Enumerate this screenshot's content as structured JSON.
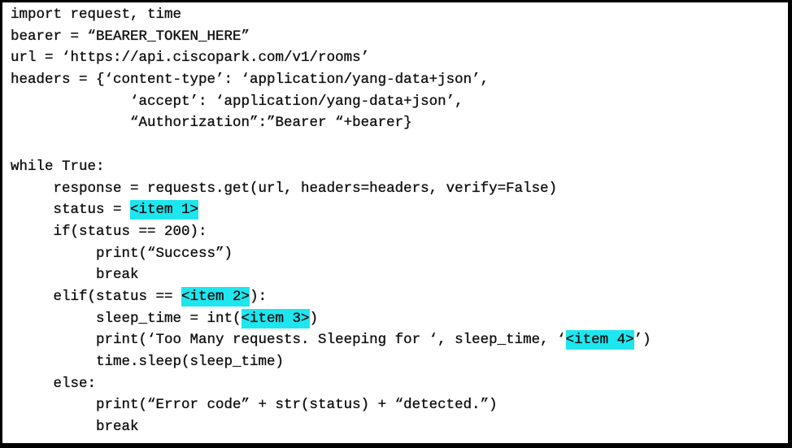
{
  "document": {
    "highlight_color": "#1ee6ef",
    "lines": [
      {
        "indent": "",
        "parts": [
          {
            "text": "import request, time"
          }
        ]
      },
      {
        "indent": "",
        "parts": [
          {
            "text": "bearer = “BEARER_TOKEN_HERE”"
          }
        ]
      },
      {
        "indent": "",
        "parts": [
          {
            "text": "url = ‘https://api.ciscopark.com/v1/rooms’"
          }
        ]
      },
      {
        "indent": "",
        "parts": [
          {
            "text": "headers = {‘content-type’: ‘application/yang-data+json’,"
          }
        ]
      },
      {
        "indent": "",
        "parts": [
          {
            "text": "              ‘accept’: ‘application/yang-data+json’,"
          }
        ]
      },
      {
        "indent": "",
        "parts": [
          {
            "text": "              “Authorization”:”Bearer “+bearer}"
          }
        ]
      },
      {
        "indent": "",
        "parts": [
          {
            "text": ""
          }
        ]
      },
      {
        "indent": "",
        "parts": [
          {
            "text": "while True:"
          }
        ]
      },
      {
        "indent": "",
        "parts": [
          {
            "text": "     response = requests.get(url, headers=headers, verify=False)"
          }
        ]
      },
      {
        "indent": "",
        "parts": [
          {
            "text": "     status = "
          },
          {
            "text": "<item 1>",
            "highlight": true
          }
        ]
      },
      {
        "indent": "",
        "parts": [
          {
            "text": "     if(status == 200):"
          }
        ]
      },
      {
        "indent": "",
        "parts": [
          {
            "text": "          print(“Success”)"
          }
        ]
      },
      {
        "indent": "",
        "parts": [
          {
            "text": "          break"
          }
        ]
      },
      {
        "indent": "",
        "parts": [
          {
            "text": "     elif(status == "
          },
          {
            "text": "<item 2>",
            "highlight": true
          },
          {
            "text": "):"
          }
        ]
      },
      {
        "indent": "",
        "parts": [
          {
            "text": "          sleep_time = int("
          },
          {
            "text": "<item 3>",
            "highlight": true
          },
          {
            "text": ")"
          }
        ]
      },
      {
        "indent": "",
        "parts": [
          {
            "text": "          print(‘Too Many requests. Sleeping for ‘, sleep_time, ‘"
          },
          {
            "text": "<item 4>",
            "highlight": true
          },
          {
            "text": "’)"
          }
        ]
      },
      {
        "indent": "",
        "parts": [
          {
            "text": "          time.sleep(sleep_time)"
          }
        ]
      },
      {
        "indent": "",
        "parts": [
          {
            "text": "     else:"
          }
        ]
      },
      {
        "indent": "",
        "parts": [
          {
            "text": "          print(“Error code” + str(status) + “detected.”)"
          }
        ]
      },
      {
        "indent": "",
        "parts": [
          {
            "text": "          break"
          }
        ]
      }
    ]
  }
}
